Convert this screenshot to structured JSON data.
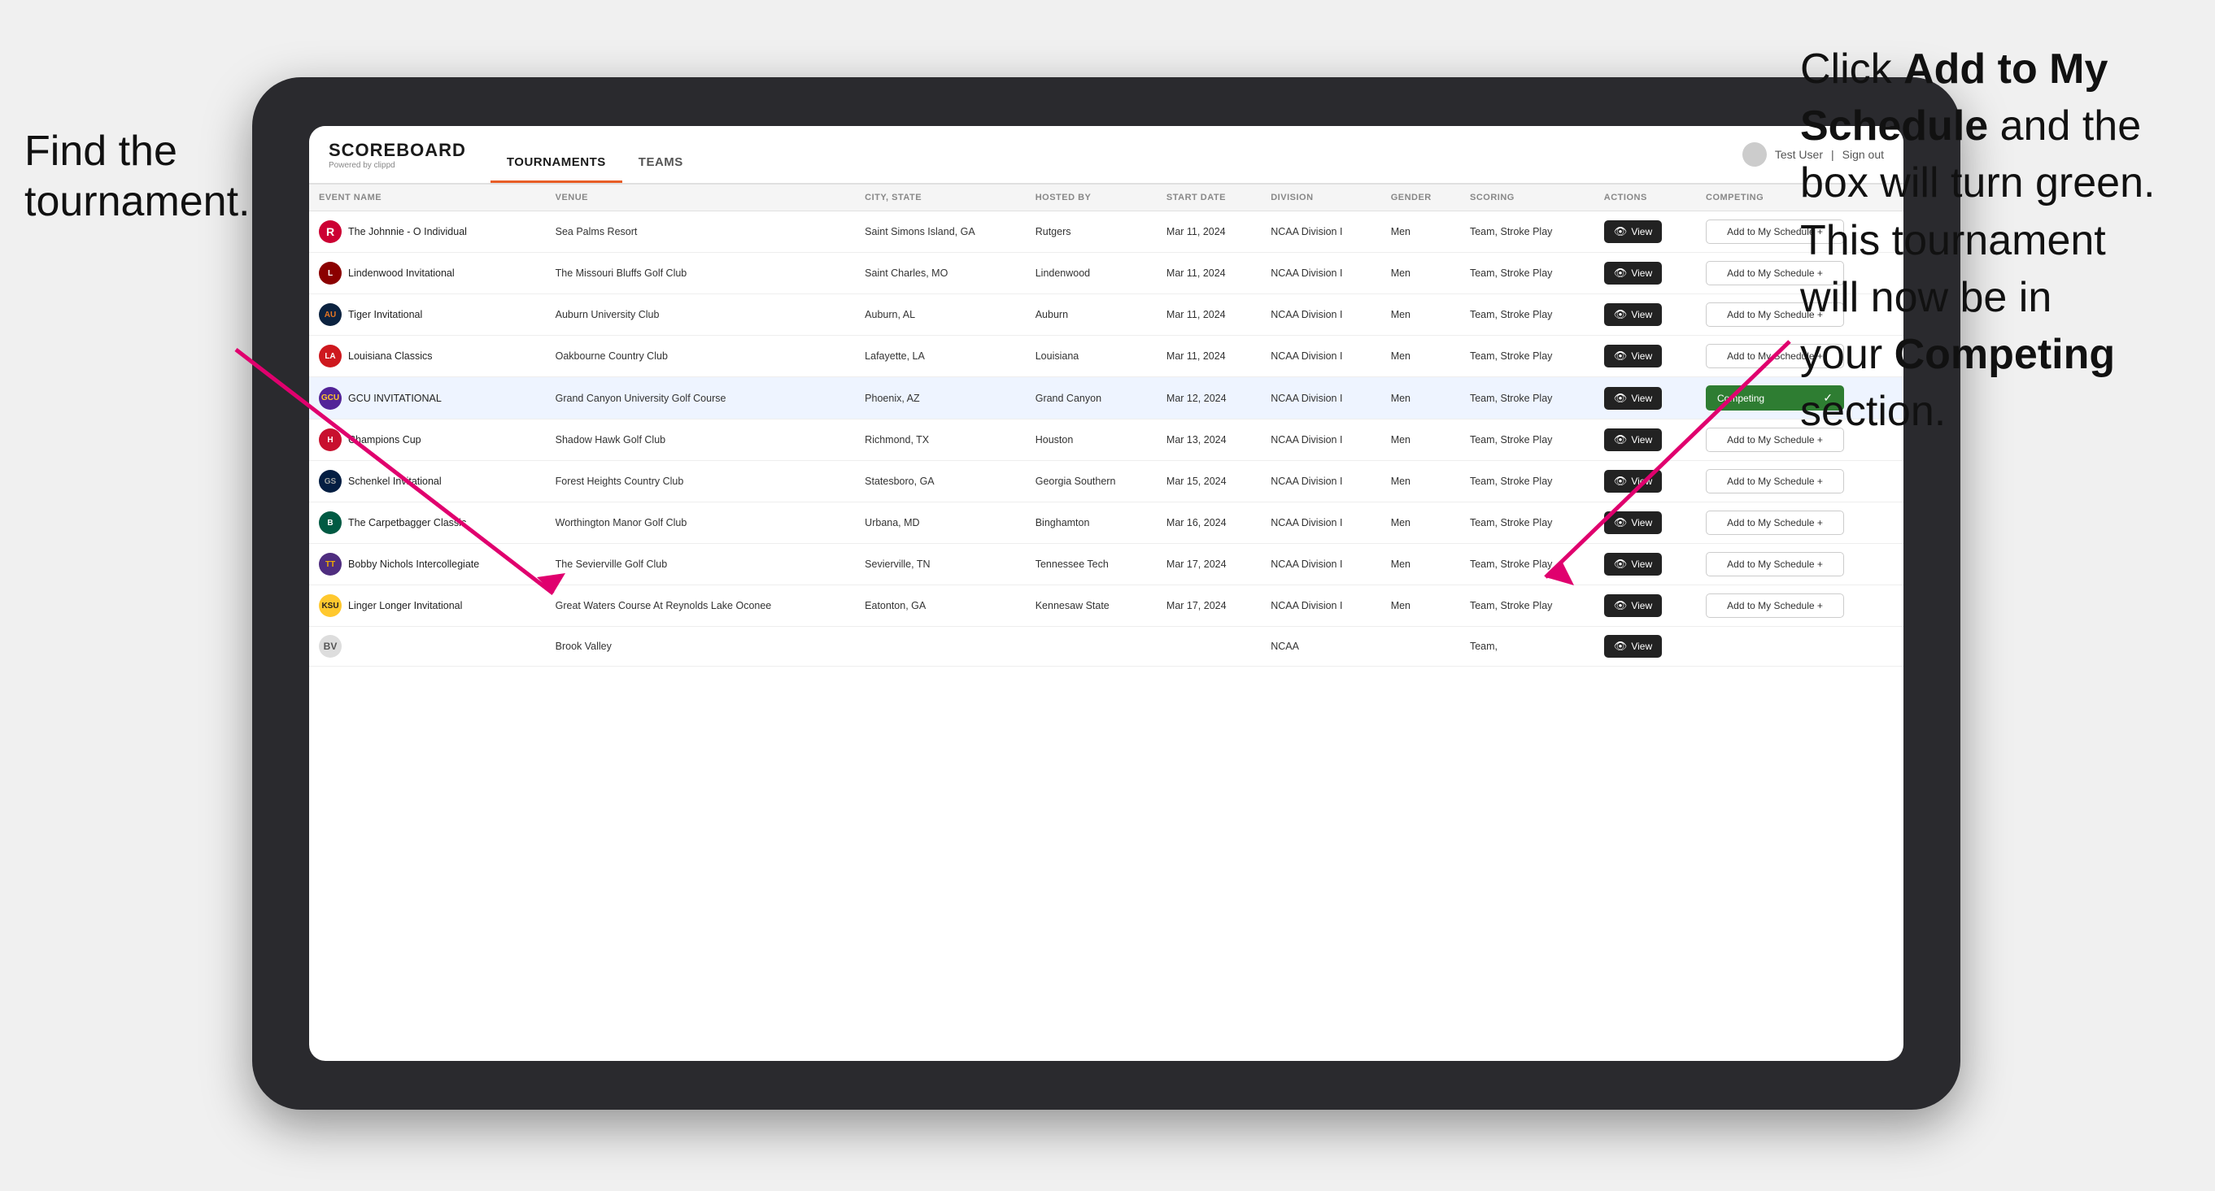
{
  "annotations": {
    "left": "Find the\ntournament.",
    "right_line1": "Click ",
    "right_bold1": "Add to My\nSchedule",
    "right_line2": " and the\nbox will turn green.\nThis tournament\nwill now be in\nyour ",
    "right_bold2": "Competing",
    "right_line3": "\nsection."
  },
  "navbar": {
    "logo_text": "SCOREBOARD",
    "logo_sub": "Powered by clippd",
    "tabs": [
      "TOURNAMENTS",
      "TEAMS"
    ],
    "active_tab": "TOURNAMENTS",
    "user_name": "Test User",
    "sign_out": "Sign out"
  },
  "table": {
    "headers": [
      "EVENT NAME",
      "VENUE",
      "CITY, STATE",
      "HOSTED BY",
      "START DATE",
      "DIVISION",
      "GENDER",
      "SCORING",
      "ACTIONS",
      "COMPETING"
    ],
    "rows": [
      {
        "logo_label": "R",
        "logo_class": "logo-rutgers",
        "event_name": "The Johnnie - O Individual",
        "venue": "Sea Palms Resort",
        "city_state": "Saint Simons Island, GA",
        "hosted_by": "Rutgers",
        "start_date": "Mar 11, 2024",
        "division": "NCAA Division I",
        "gender": "Men",
        "scoring": "Team, Stroke Play",
        "action": "View",
        "competing": "Add to My Schedule +",
        "is_competing": false,
        "highlighted": false
      },
      {
        "logo_label": "L",
        "logo_class": "logo-lindenwood",
        "event_name": "Lindenwood Invitational",
        "venue": "The Missouri Bluffs Golf Club",
        "city_state": "Saint Charles, MO",
        "hosted_by": "Lindenwood",
        "start_date": "Mar 11, 2024",
        "division": "NCAA Division I",
        "gender": "Men",
        "scoring": "Team, Stroke Play",
        "action": "View",
        "competing": "Add to My Schedule +",
        "is_competing": false,
        "highlighted": false
      },
      {
        "logo_label": "AU",
        "logo_class": "logo-auburn",
        "event_name": "Tiger Invitational",
        "venue": "Auburn University Club",
        "city_state": "Auburn, AL",
        "hosted_by": "Auburn",
        "start_date": "Mar 11, 2024",
        "division": "NCAA Division I",
        "gender": "Men",
        "scoring": "Team, Stroke Play",
        "action": "View",
        "competing": "Add to My Schedule +",
        "is_competing": false,
        "highlighted": false
      },
      {
        "logo_label": "LA",
        "logo_class": "logo-louisiana",
        "event_name": "Louisiana Classics",
        "venue": "Oakbourne Country Club",
        "city_state": "Lafayette, LA",
        "hosted_by": "Louisiana",
        "start_date": "Mar 11, 2024",
        "division": "NCAA Division I",
        "gender": "Men",
        "scoring": "Team, Stroke Play",
        "action": "View",
        "competing": "Add to My Schedule +",
        "is_competing": false,
        "highlighted": false
      },
      {
        "logo_label": "GCU",
        "logo_class": "logo-gcu",
        "event_name": "GCU INVITATIONAL",
        "venue": "Grand Canyon University Golf Course",
        "city_state": "Phoenix, AZ",
        "hosted_by": "Grand Canyon",
        "start_date": "Mar 12, 2024",
        "division": "NCAA Division I",
        "gender": "Men",
        "scoring": "Team, Stroke Play",
        "action": "View",
        "competing": "Competing",
        "is_competing": true,
        "highlighted": true
      },
      {
        "logo_label": "H",
        "logo_class": "logo-houston",
        "event_name": "Champions Cup",
        "venue": "Shadow Hawk Golf Club",
        "city_state": "Richmond, TX",
        "hosted_by": "Houston",
        "start_date": "Mar 13, 2024",
        "division": "NCAA Division I",
        "gender": "Men",
        "scoring": "Team, Stroke Play",
        "action": "View",
        "competing": "Add to My Schedule +",
        "is_competing": false,
        "highlighted": false
      },
      {
        "logo_label": "GS",
        "logo_class": "logo-georgia-southern",
        "event_name": "Schenkel Invitational",
        "venue": "Forest Heights Country Club",
        "city_state": "Statesboro, GA",
        "hosted_by": "Georgia Southern",
        "start_date": "Mar 15, 2024",
        "division": "NCAA Division I",
        "gender": "Men",
        "scoring": "Team, Stroke Play",
        "action": "View",
        "competing": "Add to My Schedule +",
        "is_competing": false,
        "highlighted": false
      },
      {
        "logo_label": "B",
        "logo_class": "logo-binghamton",
        "event_name": "The Carpetbagger Classic",
        "venue": "Worthington Manor Golf Club",
        "city_state": "Urbana, MD",
        "hosted_by": "Binghamton",
        "start_date": "Mar 16, 2024",
        "division": "NCAA Division I",
        "gender": "Men",
        "scoring": "Team, Stroke Play",
        "action": "View",
        "competing": "Add to My Schedule +",
        "is_competing": false,
        "highlighted": false
      },
      {
        "logo_label": "TT",
        "logo_class": "logo-tennessee-tech",
        "event_name": "Bobby Nichols Intercollegiate",
        "venue": "The Sevierville Golf Club",
        "city_state": "Sevierville, TN",
        "hosted_by": "Tennessee Tech",
        "start_date": "Mar 17, 2024",
        "division": "NCAA Division I",
        "gender": "Men",
        "scoring": "Team, Stroke Play",
        "action": "View",
        "competing": "Add to My Schedule +",
        "is_competing": false,
        "highlighted": false
      },
      {
        "logo_label": "KSU",
        "logo_class": "logo-kennesaw",
        "event_name": "Linger Longer Invitational",
        "venue": "Great Waters Course At Reynolds Lake Oconee",
        "city_state": "Eatonton, GA",
        "hosted_by": "Kennesaw State",
        "start_date": "Mar 17, 2024",
        "division": "NCAA Division I",
        "gender": "Men",
        "scoring": "Team, Stroke Play",
        "action": "View",
        "competing": "Add to My Schedule +",
        "is_competing": false,
        "highlighted": false
      },
      {
        "logo_label": "BV",
        "logo_class": "",
        "event_name": "",
        "venue": "Brook Valley",
        "city_state": "",
        "hosted_by": "",
        "start_date": "",
        "division": "NCAA",
        "gender": "",
        "scoring": "Team,",
        "action": "View",
        "competing": "",
        "is_competing": false,
        "highlighted": false
      }
    ]
  },
  "colors": {
    "competing_green": "#2e7d32",
    "nav_accent": "#e85d26",
    "dark_button": "#222222"
  }
}
